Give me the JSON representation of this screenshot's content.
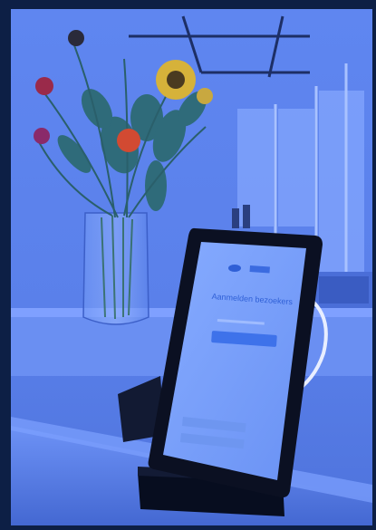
{
  "scene": {
    "tablet": {
      "heading": "Aanmelden bezoekers"
    },
    "colors": {
      "background": "#0d1f45",
      "wall": "#5a80ea",
      "tablet_frame": "#0b1022",
      "tablet_screen": "#7aa2ff",
      "counter": "#5b82ec",
      "stand": "#070d1f",
      "sunflower": "#d6b23a",
      "red_flower": "#d24a32",
      "leaves": "#2f6b7a"
    }
  }
}
